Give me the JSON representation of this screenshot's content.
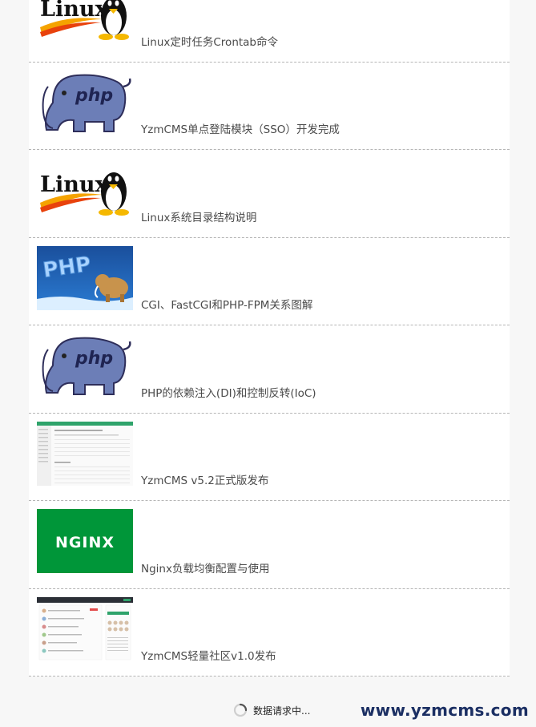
{
  "articles": [
    {
      "title": "Linux定时任务Crontab命令",
      "thumb": "linux-logo"
    },
    {
      "title": "YzmCMS单点登陆模块（SSO）开发完成",
      "thumb": "php-elephant"
    },
    {
      "title": "Linux系统目录结构说明",
      "thumb": "linux-logo"
    },
    {
      "title": "CGI、FastCGI和PHP-FPM关系图解",
      "thumb": "php-ice-mammoth"
    },
    {
      "title": "PHP的依赖注入(DI)和控制反转(IoC)",
      "thumb": "php-elephant"
    },
    {
      "title": "YzmCMS v5.2正式版发布",
      "thumb": "admin-screenshot"
    },
    {
      "title": "Nginx负载均衡配置与使用",
      "thumb": "nginx-logo"
    },
    {
      "title": "YzmCMS轻量社区v1.0发布",
      "thumb": "community-screenshot"
    }
  ],
  "thumb_text": {
    "linux": "Linux",
    "php": "php",
    "php_ice": "PHP",
    "nginx": "NGINX"
  },
  "loading": {
    "text": "数据请求中..."
  },
  "watermark": {
    "text": "www.yzmcms.com"
  },
  "colors": {
    "nginx_green": "#009639",
    "php_purple": "#6c7eb7",
    "watermark_navy": "#1b2f63"
  }
}
